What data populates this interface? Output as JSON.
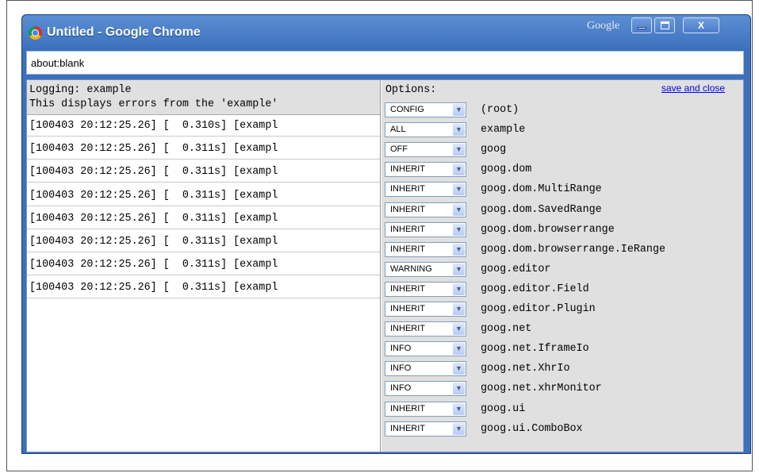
{
  "window": {
    "title": "Untitled - Google Chrome",
    "brand": "Google",
    "close_glyph": "X",
    "address": "about:blank",
    "accent_color": "#3d6fba"
  },
  "log": {
    "title": "Logging: example",
    "description": "This displays errors from the 'example'",
    "entries": [
      "[100403 20:12:25.26] [  0.310s] [exampl",
      "[100403 20:12:25.26] [  0.311s] [exampl",
      "[100403 20:12:25.26] [  0.311s] [exampl",
      "[100403 20:12:25.26] [  0.311s] [exampl",
      "[100403 20:12:25.26] [  0.311s] [exampl",
      "[100403 20:12:25.26] [  0.311s] [exampl",
      "[100403 20:12:25.26] [  0.311s] [exampl",
      "[100403 20:12:25.26] [  0.311s] [exampl"
    ]
  },
  "options": {
    "title": "Options:",
    "save_label": "save and close",
    "loggers": [
      {
        "level": "CONFIG",
        "name": "(root)"
      },
      {
        "level": "ALL",
        "name": "example"
      },
      {
        "level": "OFF",
        "name": "goog"
      },
      {
        "level": "INHERIT",
        "name": "goog.dom"
      },
      {
        "level": "INHERIT",
        "name": "goog.dom.MultiRange"
      },
      {
        "level": "INHERIT",
        "name": "goog.dom.SavedRange"
      },
      {
        "level": "INHERIT",
        "name": "goog.dom.browserrange"
      },
      {
        "level": "INHERIT",
        "name": "goog.dom.browserrange.IeRange"
      },
      {
        "level": "WARNING",
        "name": "goog.editor"
      },
      {
        "level": "INHERIT",
        "name": "goog.editor.Field"
      },
      {
        "level": "INHERIT",
        "name": "goog.editor.Plugin"
      },
      {
        "level": "INHERIT",
        "name": "goog.net"
      },
      {
        "level": "INFO",
        "name": "goog.net.IframeIo"
      },
      {
        "level": "INFO",
        "name": "goog.net.XhrIo"
      },
      {
        "level": "INFO",
        "name": "goog.net.xhrMonitor"
      },
      {
        "level": "INHERIT",
        "name": "goog.ui"
      },
      {
        "level": "INHERIT",
        "name": "goog.ui.ComboBox"
      }
    ]
  }
}
